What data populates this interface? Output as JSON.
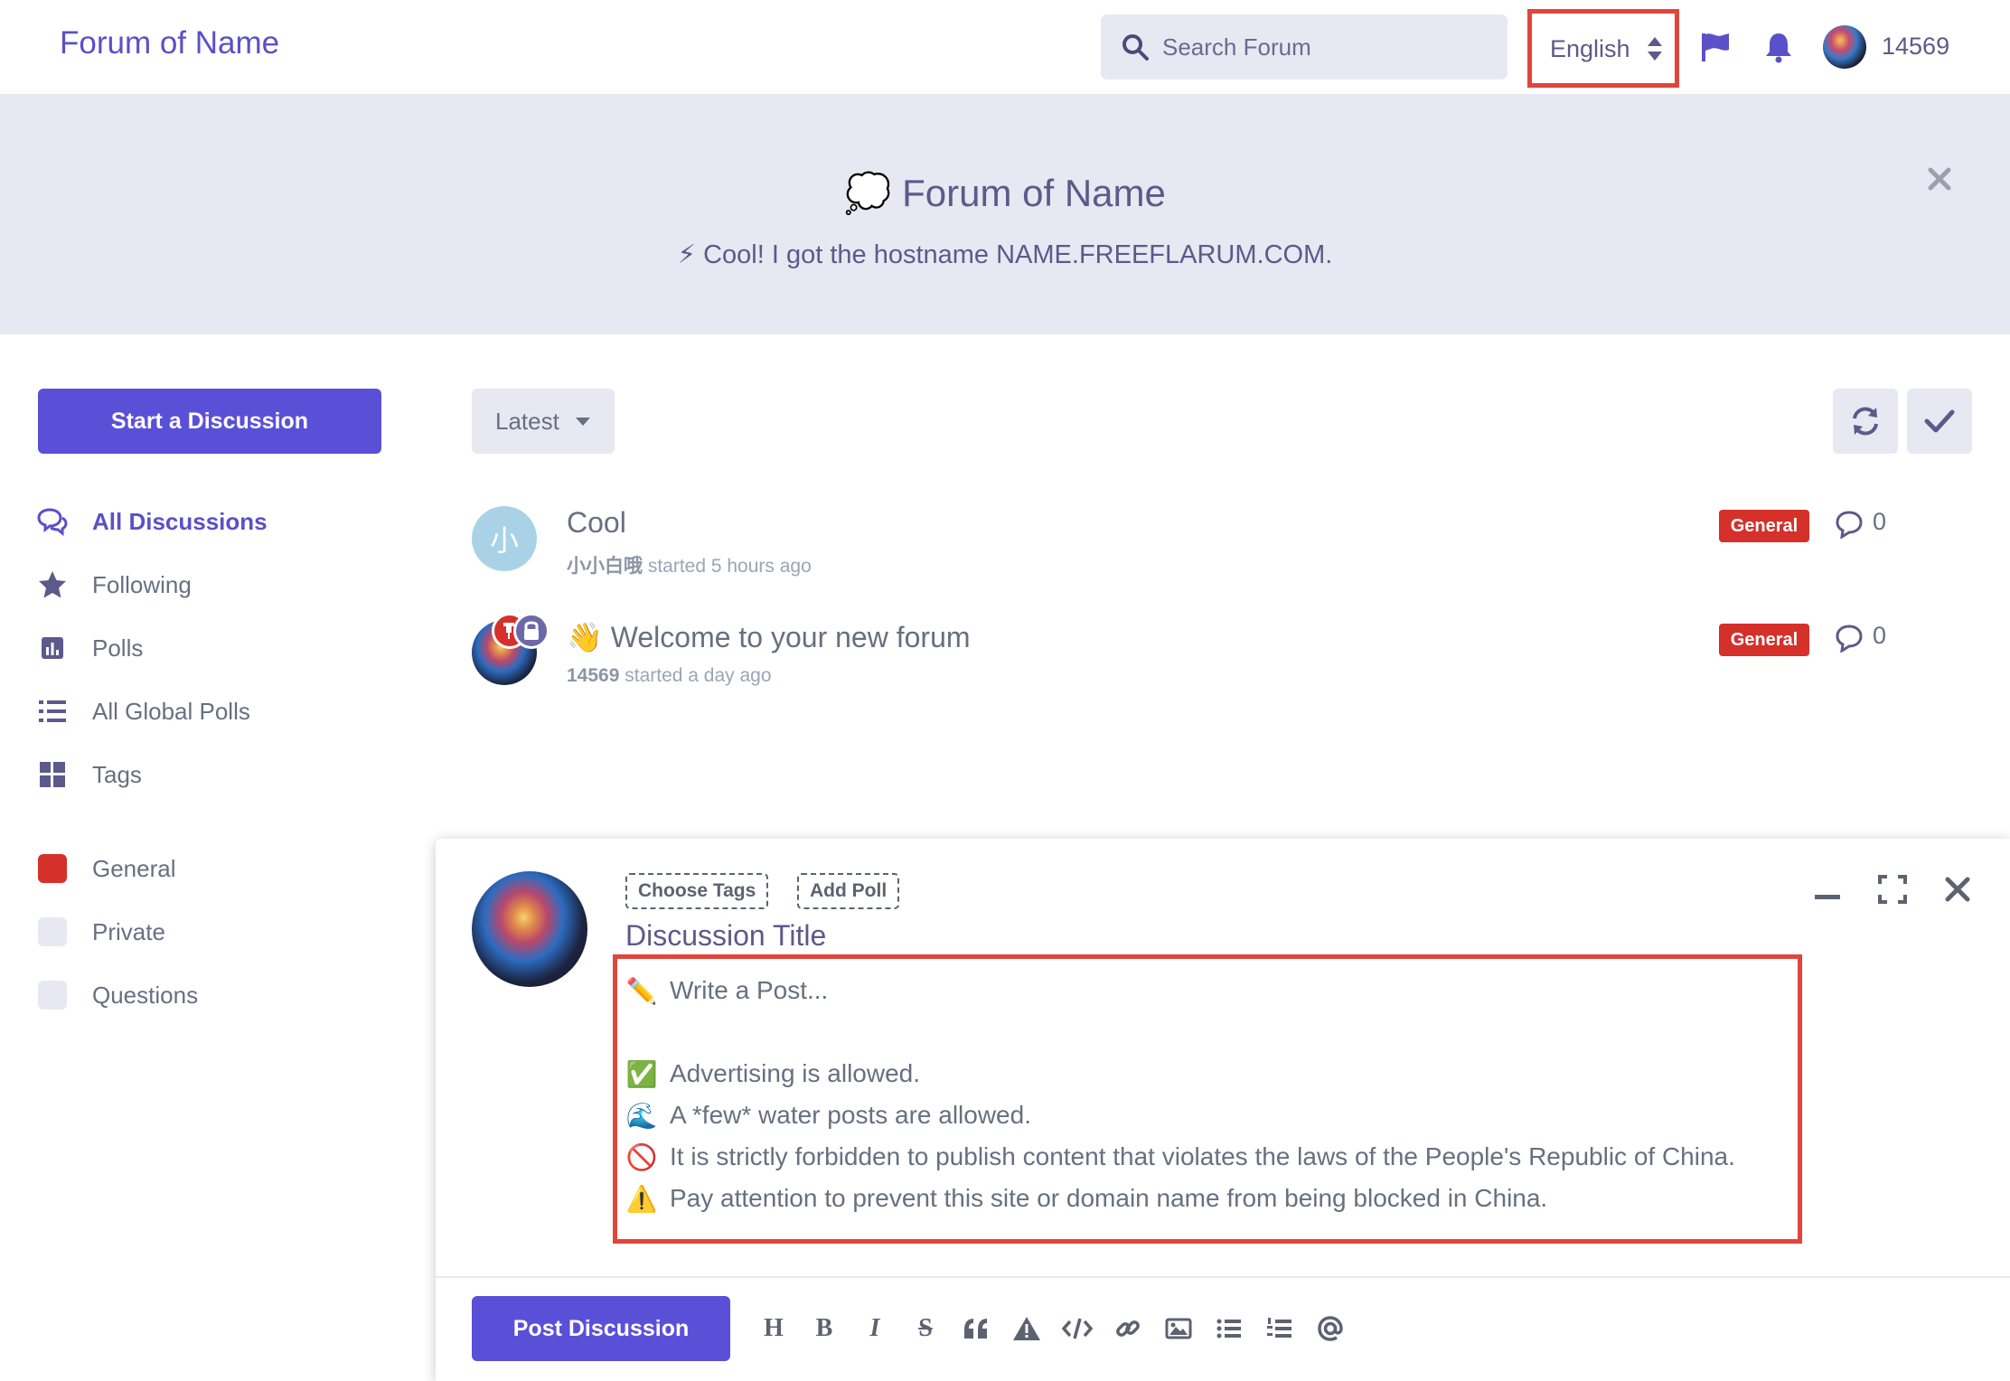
{
  "header": {
    "logo": "Forum of Name",
    "search_placeholder": "Search Forum",
    "language": "English",
    "username": "14569"
  },
  "hero": {
    "title": "💭 Forum of Name",
    "subtitle": "⚡ Cool! I got the hostname NAME.FREEFLARUM.COM."
  },
  "sidebar": {
    "start_button": "Start a Discussion",
    "nav": [
      {
        "label": "All Discussions",
        "icon": "comments-icon",
        "active": true
      },
      {
        "label": "Following",
        "icon": "star-icon"
      },
      {
        "label": "Polls",
        "icon": "poll-icon"
      },
      {
        "label": "All Global Polls",
        "icon": "list-icon"
      },
      {
        "label": "Tags",
        "icon": "tags-grid-icon"
      }
    ],
    "tags": [
      {
        "label": "General",
        "color": "#d5302a"
      },
      {
        "label": "Private",
        "color": "#e8e8f2"
      },
      {
        "label": "Questions",
        "color": "#e8e8f2"
      }
    ]
  },
  "toolbar": {
    "sort_label": "Latest"
  },
  "discussions": [
    {
      "title": "Cool",
      "author": "小小白哦",
      "meta": " started 5 hours ago",
      "avatar_letter": "小",
      "avatar_color": "#a9d2e6",
      "tag": "General",
      "replies": "0"
    },
    {
      "title": "👋 Welcome to your new forum",
      "author": "14569",
      "meta": " started a day ago",
      "tag": "General",
      "replies": "0"
    }
  ],
  "composer": {
    "choose_tags": "Choose Tags",
    "add_poll": "Add Poll",
    "title_placeholder": "Discussion Title",
    "body_lines": [
      {
        "emoji": "✏️",
        "text": "Write a Post..."
      },
      {
        "emoji": "",
        "text": ""
      },
      {
        "emoji": "✅",
        "text": "Advertising is allowed."
      },
      {
        "emoji": "🌊",
        "text": "A *few* water posts are allowed."
      },
      {
        "emoji": "🚫",
        "text": "It is strictly forbidden to publish content that violates the laws of the People's Republic of China."
      },
      {
        "emoji": "⚠️",
        "text": "Pay attention to prevent this site or domain name from being blocked in China."
      }
    ],
    "post_button": "Post Discussion",
    "format_tools": [
      "H",
      "B",
      "I",
      "S",
      "quote",
      "spoiler",
      "code",
      "link",
      "image",
      "bullet-list",
      "ordered-list",
      "mention"
    ]
  },
  "colors": {
    "accent": "#5a50d8",
    "tag_general": "#d5302a",
    "highlight": "#e0463b",
    "header_bg": "#e8e8f2"
  }
}
